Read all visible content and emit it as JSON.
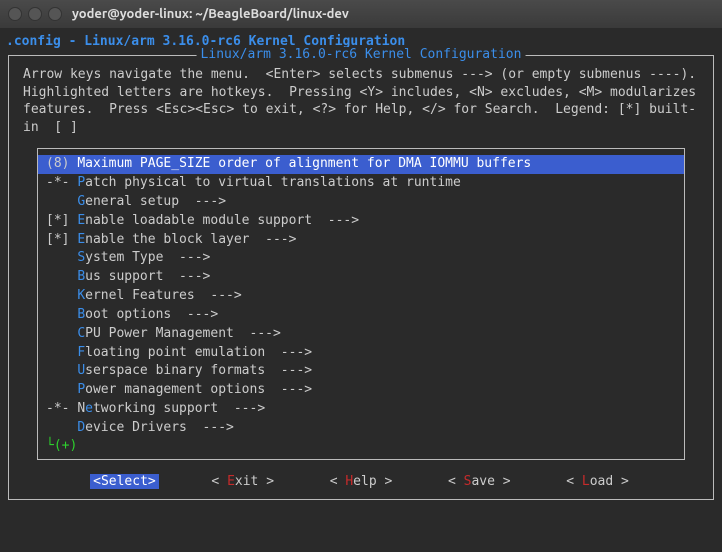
{
  "window": {
    "title": "yoder@yoder-linux: ~/BeagleBoard/linux-dev"
  },
  "header": {
    "left": ".config",
    "sep": " - ",
    "right": "Linux/arm 3.16.0-rc6 Kernel Configuration"
  },
  "box": {
    "title": "Linux/arm 3.16.0-rc6 Kernel Configuration",
    "instructions": "Arrow keys navigate the menu.  <Enter> selects submenus ---> (or empty submenus ----).  Highlighted letters are hotkeys.  Pressing <Y> includes, <N> excludes, <M> modularizes features.  Press <Esc><Esc> to exit, <?> for Help, </> for Search.  Legend: [*] built-in  [ ]"
  },
  "menu": [
    {
      "prefix": "(8) ",
      "hotpos": 2,
      "text": "Maximum PAGE_SIZE order of alignment for DMA IOMMU buffers",
      "selected": true
    },
    {
      "prefix": "-*- ",
      "hotpos": 0,
      "text": "Patch physical to virtual translations at runtime"
    },
    {
      "prefix": "    ",
      "hotpos": 0,
      "text": "General setup  --->"
    },
    {
      "prefix": "[*] ",
      "hotpos": 0,
      "text": "Enable loadable module support  --->"
    },
    {
      "prefix": "[*] ",
      "hotpos": 0,
      "text": "Enable the block layer  --->"
    },
    {
      "prefix": "    ",
      "hotpos": 0,
      "text": "System Type  --->"
    },
    {
      "prefix": "    ",
      "hotpos": 0,
      "text": "Bus support  --->"
    },
    {
      "prefix": "    ",
      "hotpos": 0,
      "text": "Kernel Features  --->"
    },
    {
      "prefix": "    ",
      "hotpos": 0,
      "text": "Boot options  --->"
    },
    {
      "prefix": "    ",
      "hotpos": 0,
      "text": "CPU Power Management  --->"
    },
    {
      "prefix": "    ",
      "hotpos": 0,
      "text": "Floating point emulation  --->"
    },
    {
      "prefix": "    ",
      "hotpos": 0,
      "text": "Userspace binary formats  --->"
    },
    {
      "prefix": "    ",
      "hotpos": 0,
      "text": "Power management options  --->"
    },
    {
      "prefix": "-*- ",
      "hotpos": 1,
      "text": "Networking support  --->"
    },
    {
      "prefix": "    ",
      "hotpos": 0,
      "text": "Device Drivers  --->"
    }
  ],
  "more_indicator": "└(+)",
  "buttons": {
    "select": {
      "open": "<",
      "hot": "S",
      "rest": "elect",
      "close": ">"
    },
    "exit": {
      "open": "< ",
      "hot": "E",
      "rest": "xit ",
      "close": ">"
    },
    "help": {
      "open": "< ",
      "hot": "H",
      "rest": "elp ",
      "close": ">"
    },
    "save": {
      "open": "< ",
      "hot": "S",
      "rest": "ave ",
      "close": ">"
    },
    "load": {
      "open": "< ",
      "hot": "L",
      "rest": "oad ",
      "close": ">"
    }
  }
}
